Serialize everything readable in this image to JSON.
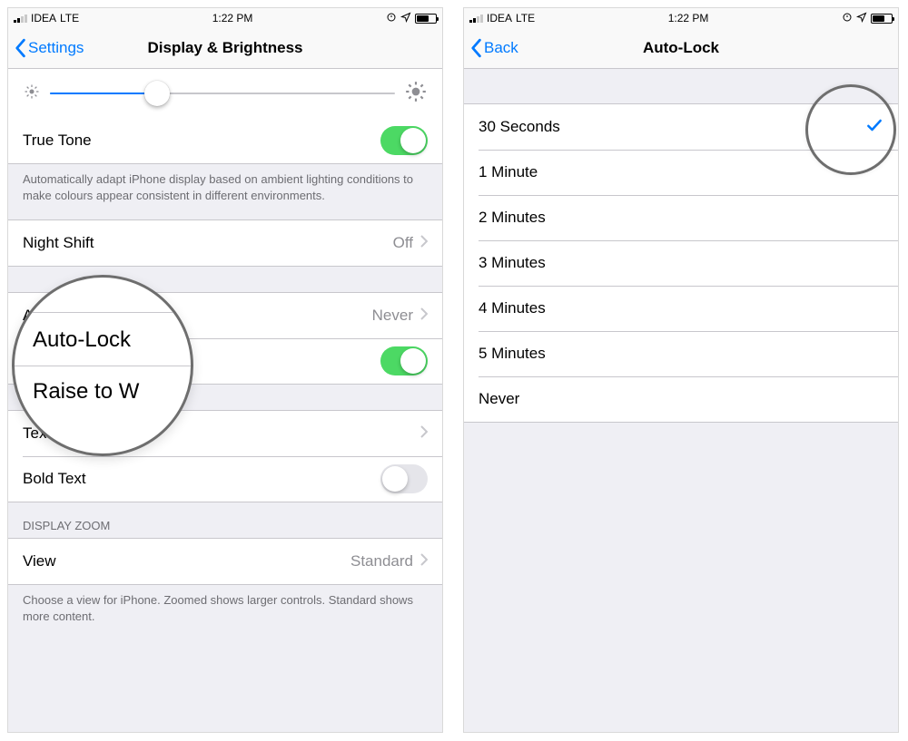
{
  "status": {
    "carrier": "IDEA",
    "network": "LTE",
    "time": "1:22 PM"
  },
  "left": {
    "back_label": "Settings",
    "title": "Display & Brightness",
    "brightness_pct": 31,
    "true_tone": {
      "label": "True Tone",
      "on": true
    },
    "true_tone_footer": "Automatically adapt iPhone display based on ambient lighting conditions to make colours appear consistent in different environments.",
    "night_shift": {
      "label": "Night Shift",
      "value": "Off"
    },
    "auto_lock": {
      "label": "Auto-Lock",
      "value": "Never"
    },
    "raise_to_wake": {
      "label": "Raise to Wake",
      "on": true
    },
    "text_size": {
      "label": "Text Size"
    },
    "bold_text": {
      "label": "Bold Text",
      "on": false
    },
    "zoom_header": "Display Zoom",
    "view": {
      "label": "View",
      "value": "Standard"
    },
    "zoom_footer": "Choose a view for iPhone. Zoomed shows larger controls. Standard shows more content.",
    "magnifier": {
      "row1": "Auto-Lock",
      "row2": "Raise to W"
    }
  },
  "right": {
    "back_label": "Back",
    "title": "Auto-Lock",
    "options": [
      {
        "label": "30 Seconds",
        "selected": true
      },
      {
        "label": "1 Minute",
        "selected": false
      },
      {
        "label": "2 Minutes",
        "selected": false
      },
      {
        "label": "3 Minutes",
        "selected": false
      },
      {
        "label": "4 Minutes",
        "selected": false
      },
      {
        "label": "5 Minutes",
        "selected": false
      },
      {
        "label": "Never",
        "selected": false
      }
    ]
  }
}
